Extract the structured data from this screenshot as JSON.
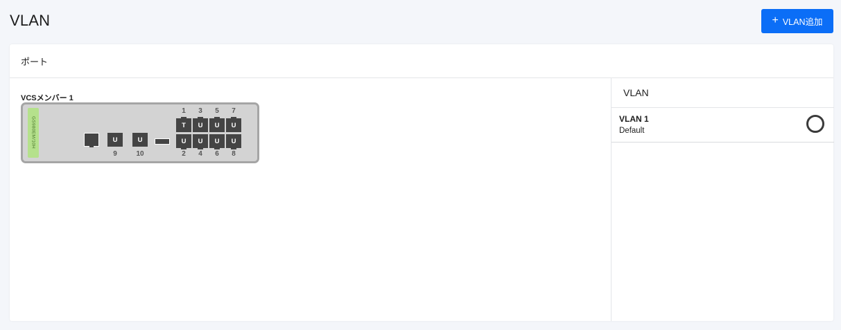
{
  "page": {
    "title": "VLAN"
  },
  "toolbar": {
    "add_vlan_label": "VLAN追加",
    "add_icon": "plus-icon"
  },
  "ports_panel": {
    "title": "ポート",
    "member_label": "VCSメンバー 1",
    "model": "GS980EM/10H",
    "top_ports": [
      {
        "number": "1",
        "mode": "T"
      },
      {
        "number": "3",
        "mode": "U"
      },
      {
        "number": "5",
        "mode": "U"
      },
      {
        "number": "7",
        "mode": "U"
      }
    ],
    "bottom_ports": [
      {
        "number": "2",
        "mode": "U"
      },
      {
        "number": "4",
        "mode": "U"
      },
      {
        "number": "6",
        "mode": "U"
      },
      {
        "number": "8",
        "mode": "U"
      }
    ],
    "sfp_ports": [
      {
        "number": "9",
        "mode": "U"
      },
      {
        "number": "10",
        "mode": "U"
      }
    ]
  },
  "vlan_panel": {
    "title": "VLAN",
    "items": [
      {
        "name": "VLAN 1",
        "description": "Default",
        "selected": false
      }
    ]
  }
}
